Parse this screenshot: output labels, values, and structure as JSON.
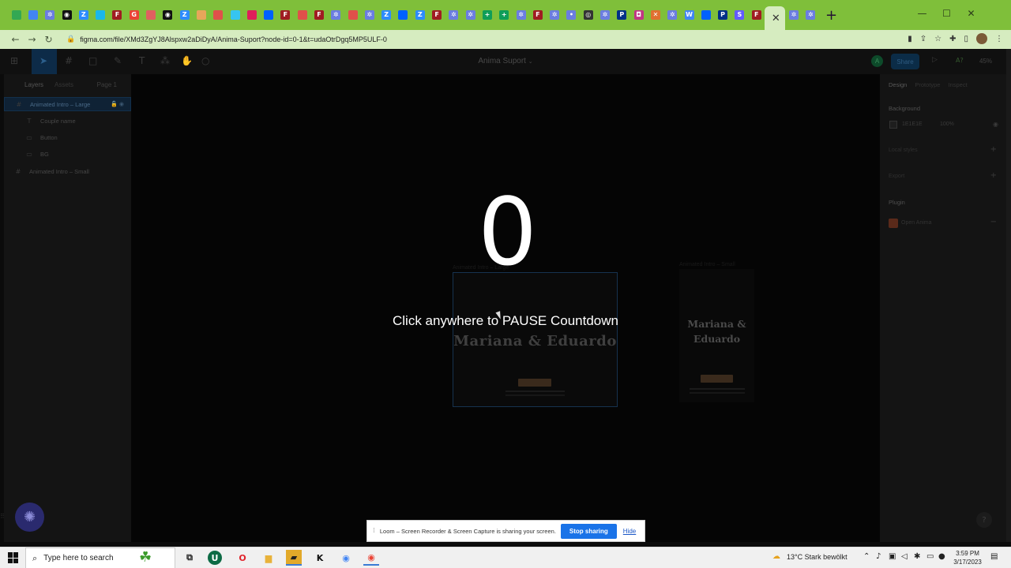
{
  "browser": {
    "tabs": [
      {
        "icon": "drive-icon",
        "color": "#34a853",
        "glyph": ""
      },
      {
        "icon": "calendar-icon",
        "color": "#4285f4",
        "glyph": ""
      },
      {
        "icon": "gear-icon",
        "color": "#6b7de0",
        "glyph": "✲"
      },
      {
        "icon": "chatgpt-icon",
        "color": "#111111",
        "glyph": "◉"
      },
      {
        "icon": "zoom-icon",
        "color": "#2d8cff",
        "glyph": "Z"
      },
      {
        "icon": "vimeo-icon",
        "color": "#1ab7ea",
        "glyph": ""
      },
      {
        "icon": "figma-icon",
        "color": "#a01c22",
        "glyph": "F"
      },
      {
        "icon": "google-icon",
        "color": "#ea4335",
        "glyph": "G"
      },
      {
        "icon": "bookmark-icon",
        "color": "#e06060",
        "glyph": ""
      },
      {
        "icon": "chatgpt-icon",
        "color": "#111111",
        "glyph": "◉"
      },
      {
        "icon": "zoom-icon",
        "color": "#2d8cff",
        "glyph": "Z"
      },
      {
        "icon": "tag-icon",
        "color": "#e7a65a",
        "glyph": ""
      },
      {
        "icon": "flag-icon",
        "color": "#e0504a",
        "glyph": ""
      },
      {
        "icon": "slack-icon",
        "color": "#36c5f0",
        "glyph": ""
      },
      {
        "icon": "slack-icon",
        "color": "#e01e5a",
        "glyph": ""
      },
      {
        "icon": "dropbox-icon",
        "color": "#0061fe",
        "glyph": ""
      },
      {
        "icon": "figma-icon",
        "color": "#a01c22",
        "glyph": "F"
      },
      {
        "icon": "flag-icon",
        "color": "#e0504a",
        "glyph": ""
      },
      {
        "icon": "figma-icon",
        "color": "#a01c22",
        "glyph": "F"
      },
      {
        "icon": "gear-icon",
        "color": "#6b7de0",
        "glyph": "✲"
      },
      {
        "icon": "flag-icon",
        "color": "#e0504a",
        "glyph": ""
      },
      {
        "icon": "gear-icon",
        "color": "#6b7de0",
        "glyph": "✲"
      },
      {
        "icon": "zoom-icon",
        "color": "#2d8cff",
        "glyph": "Z"
      },
      {
        "icon": "dropbox-icon",
        "color": "#0061fe",
        "glyph": ""
      },
      {
        "icon": "zoom-icon",
        "color": "#2d8cff",
        "glyph": "Z"
      },
      {
        "icon": "figma-icon",
        "color": "#a01c22",
        "glyph": "F"
      },
      {
        "icon": "gear-icon",
        "color": "#6b7de0",
        "glyph": "✲"
      },
      {
        "icon": "gear-icon",
        "color": "#6b7de0",
        "glyph": "✲"
      },
      {
        "icon": "sheets-icon",
        "color": "#0f9d58",
        "glyph": "+"
      },
      {
        "icon": "sheets-icon",
        "color": "#0f9d58",
        "glyph": "+"
      },
      {
        "icon": "gear-icon",
        "color": "#6b7de0",
        "glyph": "✲"
      },
      {
        "icon": "figma-icon",
        "color": "#a01c22",
        "glyph": "F"
      },
      {
        "icon": "gear-icon",
        "color": "#6b7de0",
        "glyph": "✲"
      },
      {
        "icon": "dots-icon",
        "color": "#6b7de0",
        "glyph": "•"
      },
      {
        "icon": "openai-icon",
        "color": "#333333",
        "glyph": "◎"
      },
      {
        "icon": "gear-icon",
        "color": "#6b7de0",
        "glyph": "✲"
      },
      {
        "icon": "paypal-icon",
        "color": "#003087",
        "glyph": "P"
      },
      {
        "icon": "instagram-icon",
        "color": "#c13584",
        "glyph": "◘"
      },
      {
        "icon": "x-icon",
        "color": "#e07030",
        "glyph": "✕"
      },
      {
        "icon": "gear-icon",
        "color": "#6b7de0",
        "glyph": "✲"
      },
      {
        "icon": "translate-icon",
        "color": "#4285f4",
        "glyph": "W"
      },
      {
        "icon": "dropbox-icon",
        "color": "#0061fe",
        "glyph": ""
      },
      {
        "icon": "paypal-icon",
        "color": "#003087",
        "glyph": "P"
      },
      {
        "icon": "stripe-icon",
        "color": "#635bff",
        "glyph": "S"
      },
      {
        "icon": "figma-icon",
        "color": "#a01c22",
        "glyph": "F"
      }
    ],
    "active_tab_close": "✕",
    "active_tab_extra": [
      {
        "icon": "gear-icon",
        "color": "#6b7de0",
        "glyph": "✲"
      },
      {
        "icon": "gear-icon",
        "color": "#6b7de0",
        "glyph": "✲"
      }
    ],
    "new_tab": "+",
    "url": "figma.com/file/XMd3ZgYJ8Alspxw2aDiDyA/Anima-Suport?node-id=0-1&t=udaOtrDgq5MP5ULF-0"
  },
  "figma": {
    "file_title": "Anima Suport",
    "avatar_initial": "A",
    "share_label": "Share",
    "zoom_label": "45%",
    "left_panel": {
      "tabs": {
        "layers": "Layers",
        "assets": "Assets",
        "page": "Page 1"
      },
      "layers": [
        {
          "label": "Animated Intro – Large",
          "icon": "#",
          "selected": true,
          "child": false
        },
        {
          "label": "Couple name",
          "icon": "T",
          "selected": false,
          "child": true
        },
        {
          "label": "Button",
          "icon": "▭",
          "selected": false,
          "child": true
        },
        {
          "label": "BG",
          "icon": "▭",
          "selected": false,
          "child": true
        },
        {
          "label": "Animated Intro – Small",
          "icon": "#",
          "selected": false,
          "child": false
        }
      ]
    },
    "right_panel": {
      "tabs": {
        "design": "Design",
        "prototype": "Prototype",
        "inspect": "Inspect"
      },
      "background_label": "Background",
      "background_hex": "1E1E1E",
      "background_opacity": "100%",
      "local_styles_label": "Local styles",
      "export_label": "Export",
      "plugin_label": "Plugin",
      "plugin_name": "Open Anima"
    },
    "canvas": {
      "frame_large_label": "Animated Intro – Large",
      "frame_small_label": "Animated Intro – Small",
      "couple_name_large": "Mariana & Eduardo",
      "couple_name_small": "Mariana & Eduardo"
    }
  },
  "overlay": {
    "countdown_value": "0",
    "pause_message": "Click anywhere to PAUSE Countdown"
  },
  "loom": {
    "message": "Loom – Screen Recorder & Screen Capture is sharing your screen.",
    "stop_label": "Stop sharing",
    "hide_label": "Hide"
  },
  "taskbar": {
    "search_placeholder": "Type here to search",
    "weather": "13°C  Stark bewölkt",
    "time": "3:59 PM",
    "date": "3/17/2023"
  }
}
